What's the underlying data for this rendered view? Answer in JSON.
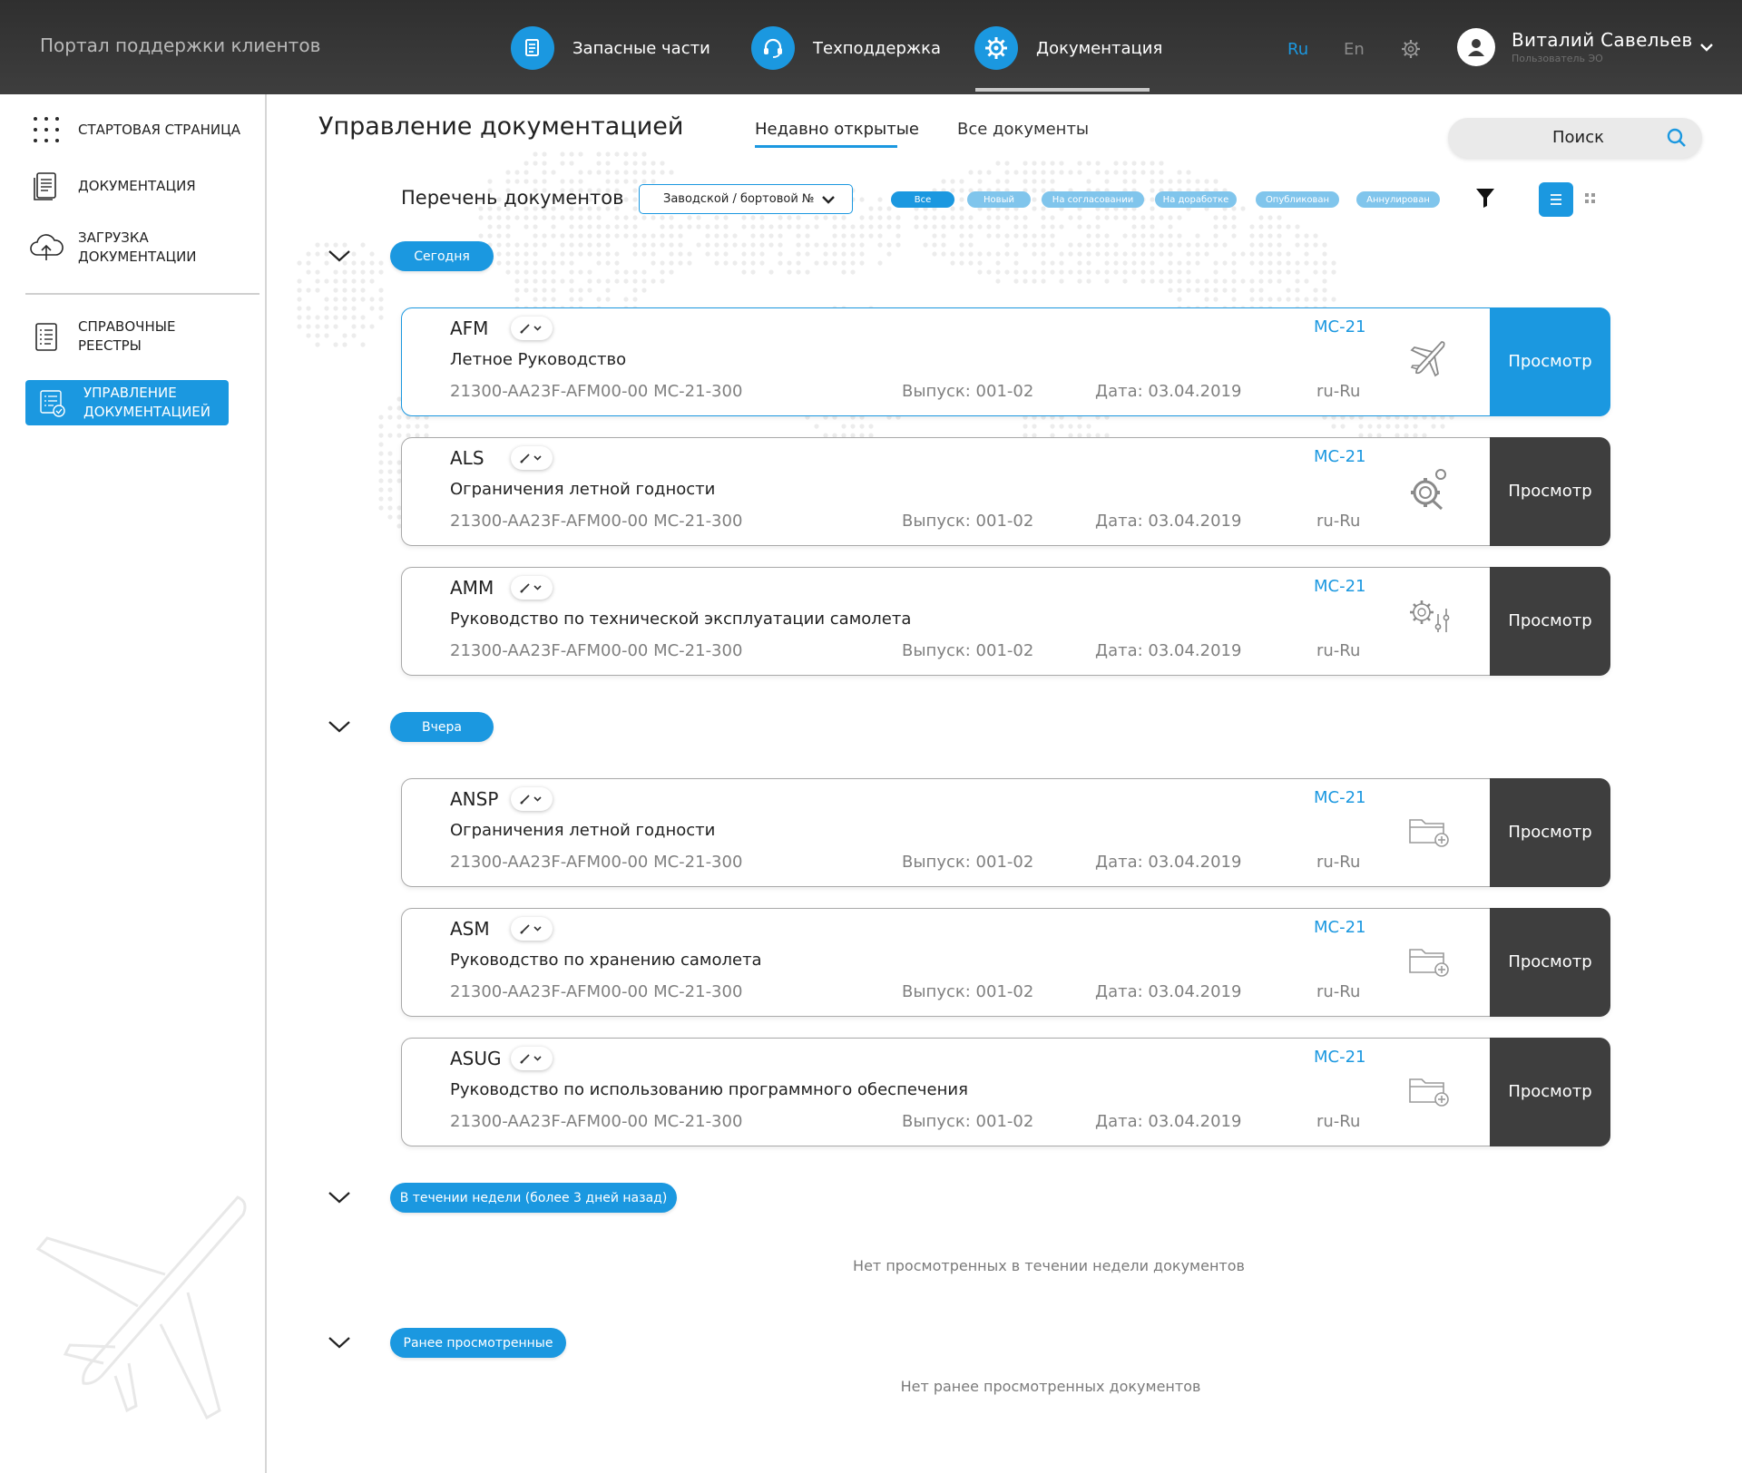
{
  "topbar": {
    "portal_title": "Портал поддержки клиентов",
    "nav": [
      {
        "label": "Запасные части",
        "icon": "parts-document-icon"
      },
      {
        "label": "Техподдержка",
        "icon": "headset-icon"
      },
      {
        "label": "Документация",
        "icon": "gear-wrench-icon"
      }
    ],
    "lang_ru": "Ru",
    "lang_en": "En",
    "user_name": "Виталий Савельев",
    "user_role": "Пользователь ЭО"
  },
  "sidebar": {
    "items": [
      {
        "label": "СТАРТОВАЯ СТРАНИЦА",
        "icon": "dots-grid-icon"
      },
      {
        "label": "ДОКУМЕНТАЦИЯ",
        "icon": "document-icon"
      },
      {
        "label": "ЗАГРУЗКА ДОКУМЕНТАЦИИ",
        "icon": "cloud-upload-icon"
      },
      {
        "label": "СПРАВОЧНЫЕ РЕЕСТРЫ",
        "icon": "checklist-icon"
      },
      {
        "label": "УПРАВЛЕНИЕ ДОКУМЕНТАЦИЕЙ",
        "icon": "document-settings-icon"
      }
    ]
  },
  "header": {
    "page_title": "Управление документацией",
    "tabs": [
      {
        "label": "Недавно открытые",
        "active": true
      },
      {
        "label": "Все документы",
        "active": false
      }
    ],
    "search_label": "Поиск"
  },
  "toolbar": {
    "list_title": "Перечень документов",
    "select_value": "Заводской / бортовой №",
    "statuses": [
      "Все",
      "Новый",
      "На согласовании",
      "На доработке",
      "Опубликован",
      "Аннулирован"
    ]
  },
  "colors": {
    "accent": "#1b98e0",
    "dark_button": "#3e3e3e",
    "topbar": "#333333"
  },
  "groups": [
    {
      "label": "Сегодня"
    },
    {
      "label": "Вчера"
    },
    {
      "label": "В течении недели (более 3 дней назад)",
      "empty": "Нет просмотренных в течении недели документов"
    },
    {
      "label": "Ранее просмотренные",
      "empty": "Нет ранее просмотренных документов"
    }
  ],
  "cards": [
    {
      "code": "AFM",
      "title": "Летное Руководство",
      "number": "21300-AA23F-AFM00-00   MC-21-300",
      "issue": "Выпуск: 001-02",
      "date": "Дата: 03.04.2019",
      "aircraft": "MC-21",
      "lang": "ru-Ru",
      "icon": "airplane-icon",
      "view": "Просмотр"
    },
    {
      "code": "ALS",
      "title": "Ограничения летной годности",
      "number": "21300-AA23F-AFM00-00   MC-21-300",
      "issue": "Выпуск: 001-02",
      "date": "Дата: 03.04.2019",
      "aircraft": "MC-21",
      "lang": "ru-Ru",
      "icon": "gear-search-icon",
      "view": "Просмотр"
    },
    {
      "code": "AMM",
      "title": "Руководство по технической эксплуатации самолета",
      "number": "21300-AA23F-AFM00-00   MC-21-300",
      "issue": "Выпуск: 001-02",
      "date": "Дата: 03.04.2019",
      "aircraft": "MC-21",
      "lang": "ru-Ru",
      "icon": "gear-sliders-icon",
      "view": "Просмотр"
    },
    {
      "code": "ANSP",
      "title": "Ограничения летной годности",
      "number": "21300-AA23F-AFM00-00   MC-21-300",
      "issue": "Выпуск: 001-02",
      "date": "Дата: 03.04.2019",
      "aircraft": "MC-21",
      "lang": "ru-Ru",
      "icon": "folder-add-icon",
      "view": "Просмотр"
    },
    {
      "code": "ASM",
      "title": "Руководство по хранению самолета",
      "number": "21300-AA23F-AFM00-00   MC-21-300",
      "issue": "Выпуск: 001-02",
      "date": "Дата: 03.04.2019",
      "aircraft": "MC-21",
      "lang": "ru-Ru",
      "icon": "folder-add-icon",
      "view": "Просмотр"
    },
    {
      "code": "ASUG",
      "title": "Руководство по использованию программного обеспечения",
      "number": "21300-AA23F-AFM00-00   MC-21-300",
      "issue": "Выпуск: 001-02",
      "date": "Дата: 03.04.2019",
      "aircraft": "MC-21",
      "lang": "ru-Ru",
      "icon": "folder-add-icon",
      "view": "Просмотр"
    }
  ]
}
